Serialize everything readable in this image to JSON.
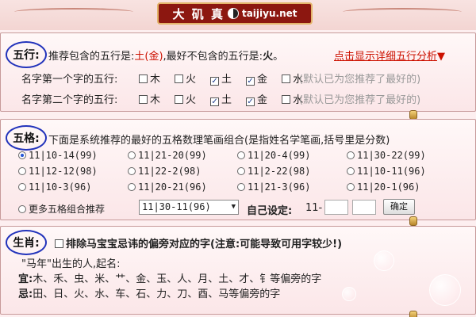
{
  "header": {
    "logo_cn": "大 矶 真",
    "logo_en": "taijiyu.net"
  },
  "wuxing": {
    "tag": "五行:",
    "rec_prefix": "推荐包含的五行是:",
    "rec_value": "土(金)",
    "avoid_prefix": ",最好不包含的五行是:",
    "avoid_value": "火",
    "detail_link": "点击显示详细五行分析",
    "detail_arrow": "▼",
    "first_label": "名字第一个字的五行:",
    "second_label": "名字第二个字的五行:",
    "elements": [
      "木",
      "火",
      "土",
      "金",
      "水"
    ],
    "first_checked": [
      false,
      false,
      true,
      true,
      false
    ],
    "second_checked": [
      false,
      false,
      true,
      true,
      false
    ],
    "note": "(默认已为您推荐了最好的)"
  },
  "wuge": {
    "tag": "五格:",
    "intro": "下面是系统推荐的最好的五格数理笔画组合(是指姓名学笔画,括号里是分数)",
    "options": [
      "11|10-14(99)",
      "11|21-20(99)",
      "11|20-4(99)",
      "11|30-22(99)",
      "11|12-12(98)",
      "11|22-2(98)",
      "11|2-22(98)",
      "11|10-11(96)",
      "11|10-3(96)",
      "11|20-21(96)",
      "11|21-3(96)",
      "11|20-1(96)"
    ],
    "selected_index": 0,
    "more_label": "更多五格组合推荐",
    "more_select": "11|30-11(96)",
    "custom_label": "自己设定:",
    "custom_prefix": "11-",
    "confirm": "确定"
  },
  "shengxiao": {
    "tag": "生肖:",
    "exclude_label": "排除马宝宝忌讳的偏旁对应的字(注意:可能导致可用字较少!)",
    "born_line": "\"马年\"出生的人,起名:",
    "yi_label": "宜:",
    "yi_text": "木、禾、虫、米、艹、金、玉、人、月、土、才、钅等偏旁的字",
    "ji_label": "忌:",
    "ji_text": "田、日、火、水、车、石、力、刀、酉、马等偏旁的字"
  },
  "colors": {
    "accent_red": "#cc1100",
    "banner_red": "#8c1710",
    "circle_blue": "#2233bb"
  }
}
